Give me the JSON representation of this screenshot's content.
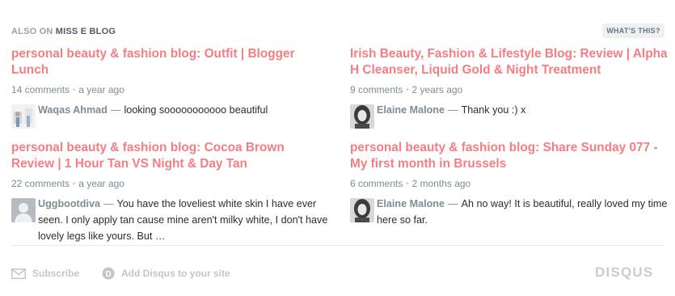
{
  "header": {
    "prefix": "ALSO ON",
    "site_name": "MISS E BLOG",
    "whats_this": "WHAT'S THIS?"
  },
  "cards": [
    {
      "title": "personal beauty & fashion blog: Outfit | Blogger Lunch",
      "comments": "14 comments",
      "time": "a year ago",
      "author": "Waqas Ahmad",
      "text": "looking sooooooooooo beautiful"
    },
    {
      "title": "Irish Beauty, Fashion & Lifestyle Blog: Review | Alpha H Cleanser, Liquid Gold & Night Treatment",
      "comments": "9 comments",
      "time": "2 years ago",
      "author": "Elaine Malone",
      "text": "Thank you :) x"
    },
    {
      "title": "personal beauty & fashion blog: Cocoa Brown Review | 1 Hour Tan VS Night & Day Tan",
      "comments": "22 comments",
      "time": "a year ago",
      "author": "Uggbootdiva",
      "text": "You have the loveliest white skin I have ever seen. I only apply tan cause mine aren't milky white, I don't have lovely legs like yours. But …"
    },
    {
      "title": "personal beauty & fashion blog: Share Sunday 077 - My first month in Brussels",
      "comments": "6 comments",
      "time": "2 months ago",
      "author": "Elaine Malone",
      "text": "Ah no way! It is beautiful, really loved my time here so far."
    }
  ],
  "footer": {
    "subscribe": "Subscribe",
    "add_disqus": "Add Disqus to your site",
    "logo": "DISQUS"
  },
  "separators": {
    "dot": "•",
    "dash": "—"
  },
  "colors": {
    "title_pink": "#f47e82",
    "meta_gray": "#7f8c95"
  }
}
